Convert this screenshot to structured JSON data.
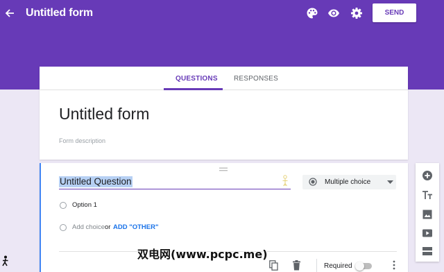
{
  "header": {
    "title": "Untitled form",
    "send_label": "SEND",
    "icons": [
      "back-arrow-icon",
      "palette-icon",
      "eye-icon",
      "gear-icon"
    ]
  },
  "tabs": [
    {
      "label": "QUESTIONS",
      "active": true
    },
    {
      "label": "RESPONSES",
      "active": false
    }
  ],
  "form": {
    "title": "Untitled form",
    "description_placeholder": "Form description"
  },
  "question": {
    "title": "Untitled Question",
    "type": "Multiple choice",
    "options": [
      "Option 1"
    ],
    "add_choice_label": "Add choice",
    "or_label": "or",
    "add_other_label": "ADD \"OTHER\"",
    "required_label": "Required",
    "required": false
  },
  "side_toolbar": {
    "icons": [
      "add-question-icon",
      "add-title-icon",
      "add-image-icon",
      "add-video-icon",
      "add-section-icon"
    ]
  },
  "watermark": "双电网(www.pcpc.me)",
  "colors": {
    "header_bg": "#673ab7",
    "page_bg": "#ece7f5",
    "accent_blue": "#4285f4",
    "link_blue": "#1a73e8"
  }
}
